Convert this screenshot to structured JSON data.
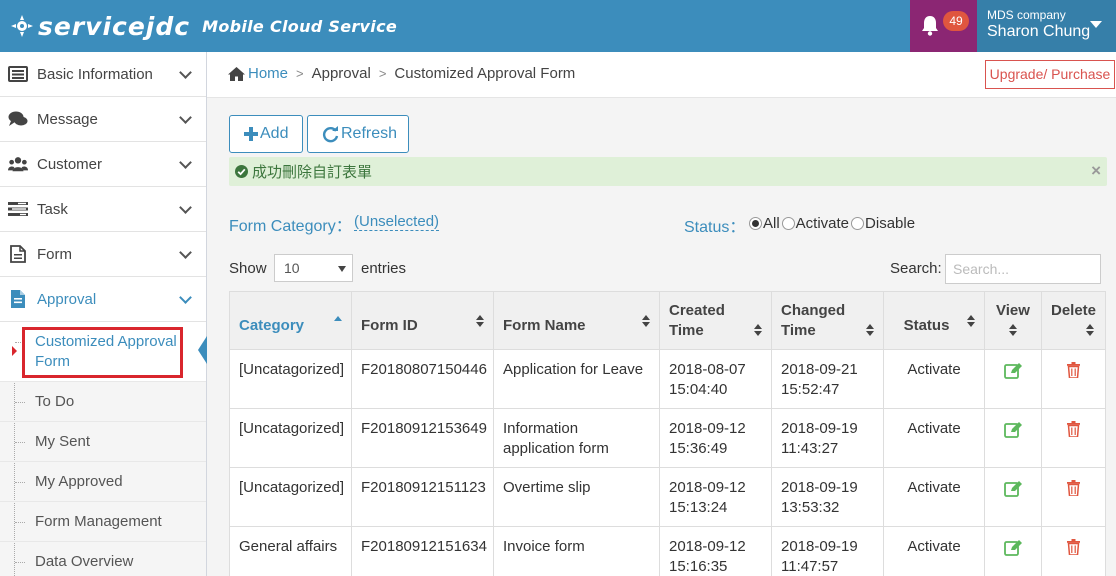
{
  "app": {
    "logo_text": "servicejdc",
    "subtitle": "Mobile Cloud Service",
    "notification_count": "49",
    "user_company": "MDS company",
    "user_name": "Sharon Chung",
    "colors": {
      "brand": "#3c8dbc",
      "notif_bg": "#8b2673",
      "badge": "#e0563f",
      "alert_bg": "#dff0d8",
      "highlight": "#d9262d"
    }
  },
  "sidebar": {
    "items": [
      {
        "label": "Basic Information",
        "icon": "list-icon"
      },
      {
        "label": "Message",
        "icon": "chat-icon"
      },
      {
        "label": "Customer",
        "icon": "users-icon"
      },
      {
        "label": "Task",
        "icon": "tasks-icon"
      },
      {
        "label": "Form",
        "icon": "form-icon"
      },
      {
        "label": "Approval",
        "icon": "approval-icon"
      }
    ],
    "sub_items": [
      {
        "label": "Customized Approval Form"
      },
      {
        "label": "To Do"
      },
      {
        "label": "My Sent"
      },
      {
        "label": "My Approved"
      },
      {
        "label": "Form Management"
      },
      {
        "label": "Data Overview"
      }
    ]
  },
  "breadcrumb": {
    "home": "Home",
    "level1": "Approval",
    "level2": "Customized Approval Form",
    "upgrade": "Upgrade/ Purchase"
  },
  "toolbar": {
    "add": "Add",
    "refresh": "Refresh"
  },
  "alert": {
    "message": "成功刪除自訂表單",
    "close": "×"
  },
  "filters": {
    "form_category_label": "Form Category：",
    "form_category_value": "(Unselected)",
    "status_label": "Status：",
    "status_options": [
      "All",
      "Activate",
      "Disable"
    ],
    "status_selected": "All"
  },
  "table_controls": {
    "show_label": "Show",
    "page_size": "10",
    "entries_label": "entries",
    "search_label": "Search:",
    "search_placeholder": "Search..."
  },
  "table": {
    "columns": [
      "Category",
      "Form ID",
      "Form Name",
      "Created Time",
      "Changed Time",
      "Status",
      "View",
      "Delete"
    ],
    "rows": [
      {
        "category": "[Uncatagorized]",
        "form_id": "F20180807150446",
        "form_name": "Application for Leave",
        "created": "2018-08-07 15:04:40",
        "changed": "2018-09-21 15:52:47",
        "status": "Activate"
      },
      {
        "category": "[Uncatagorized]",
        "form_id": "F20180912153649",
        "form_name": "Information application form",
        "created": "2018-09-12 15:36:49",
        "changed": "2018-09-19 11:43:27",
        "status": "Activate"
      },
      {
        "category": "[Uncatagorized]",
        "form_id": "F20180912151123",
        "form_name": "Overtime slip",
        "created": "2018-09-12 15:13:24",
        "changed": "2018-09-19 13:53:32",
        "status": "Activate"
      },
      {
        "category": "General affairs",
        "form_id": "F20180912151634",
        "form_name": "Invoice form",
        "created": "2018-09-12 15:16:35",
        "changed": "2018-09-19 11:47:57",
        "status": "Activate"
      }
    ]
  }
}
